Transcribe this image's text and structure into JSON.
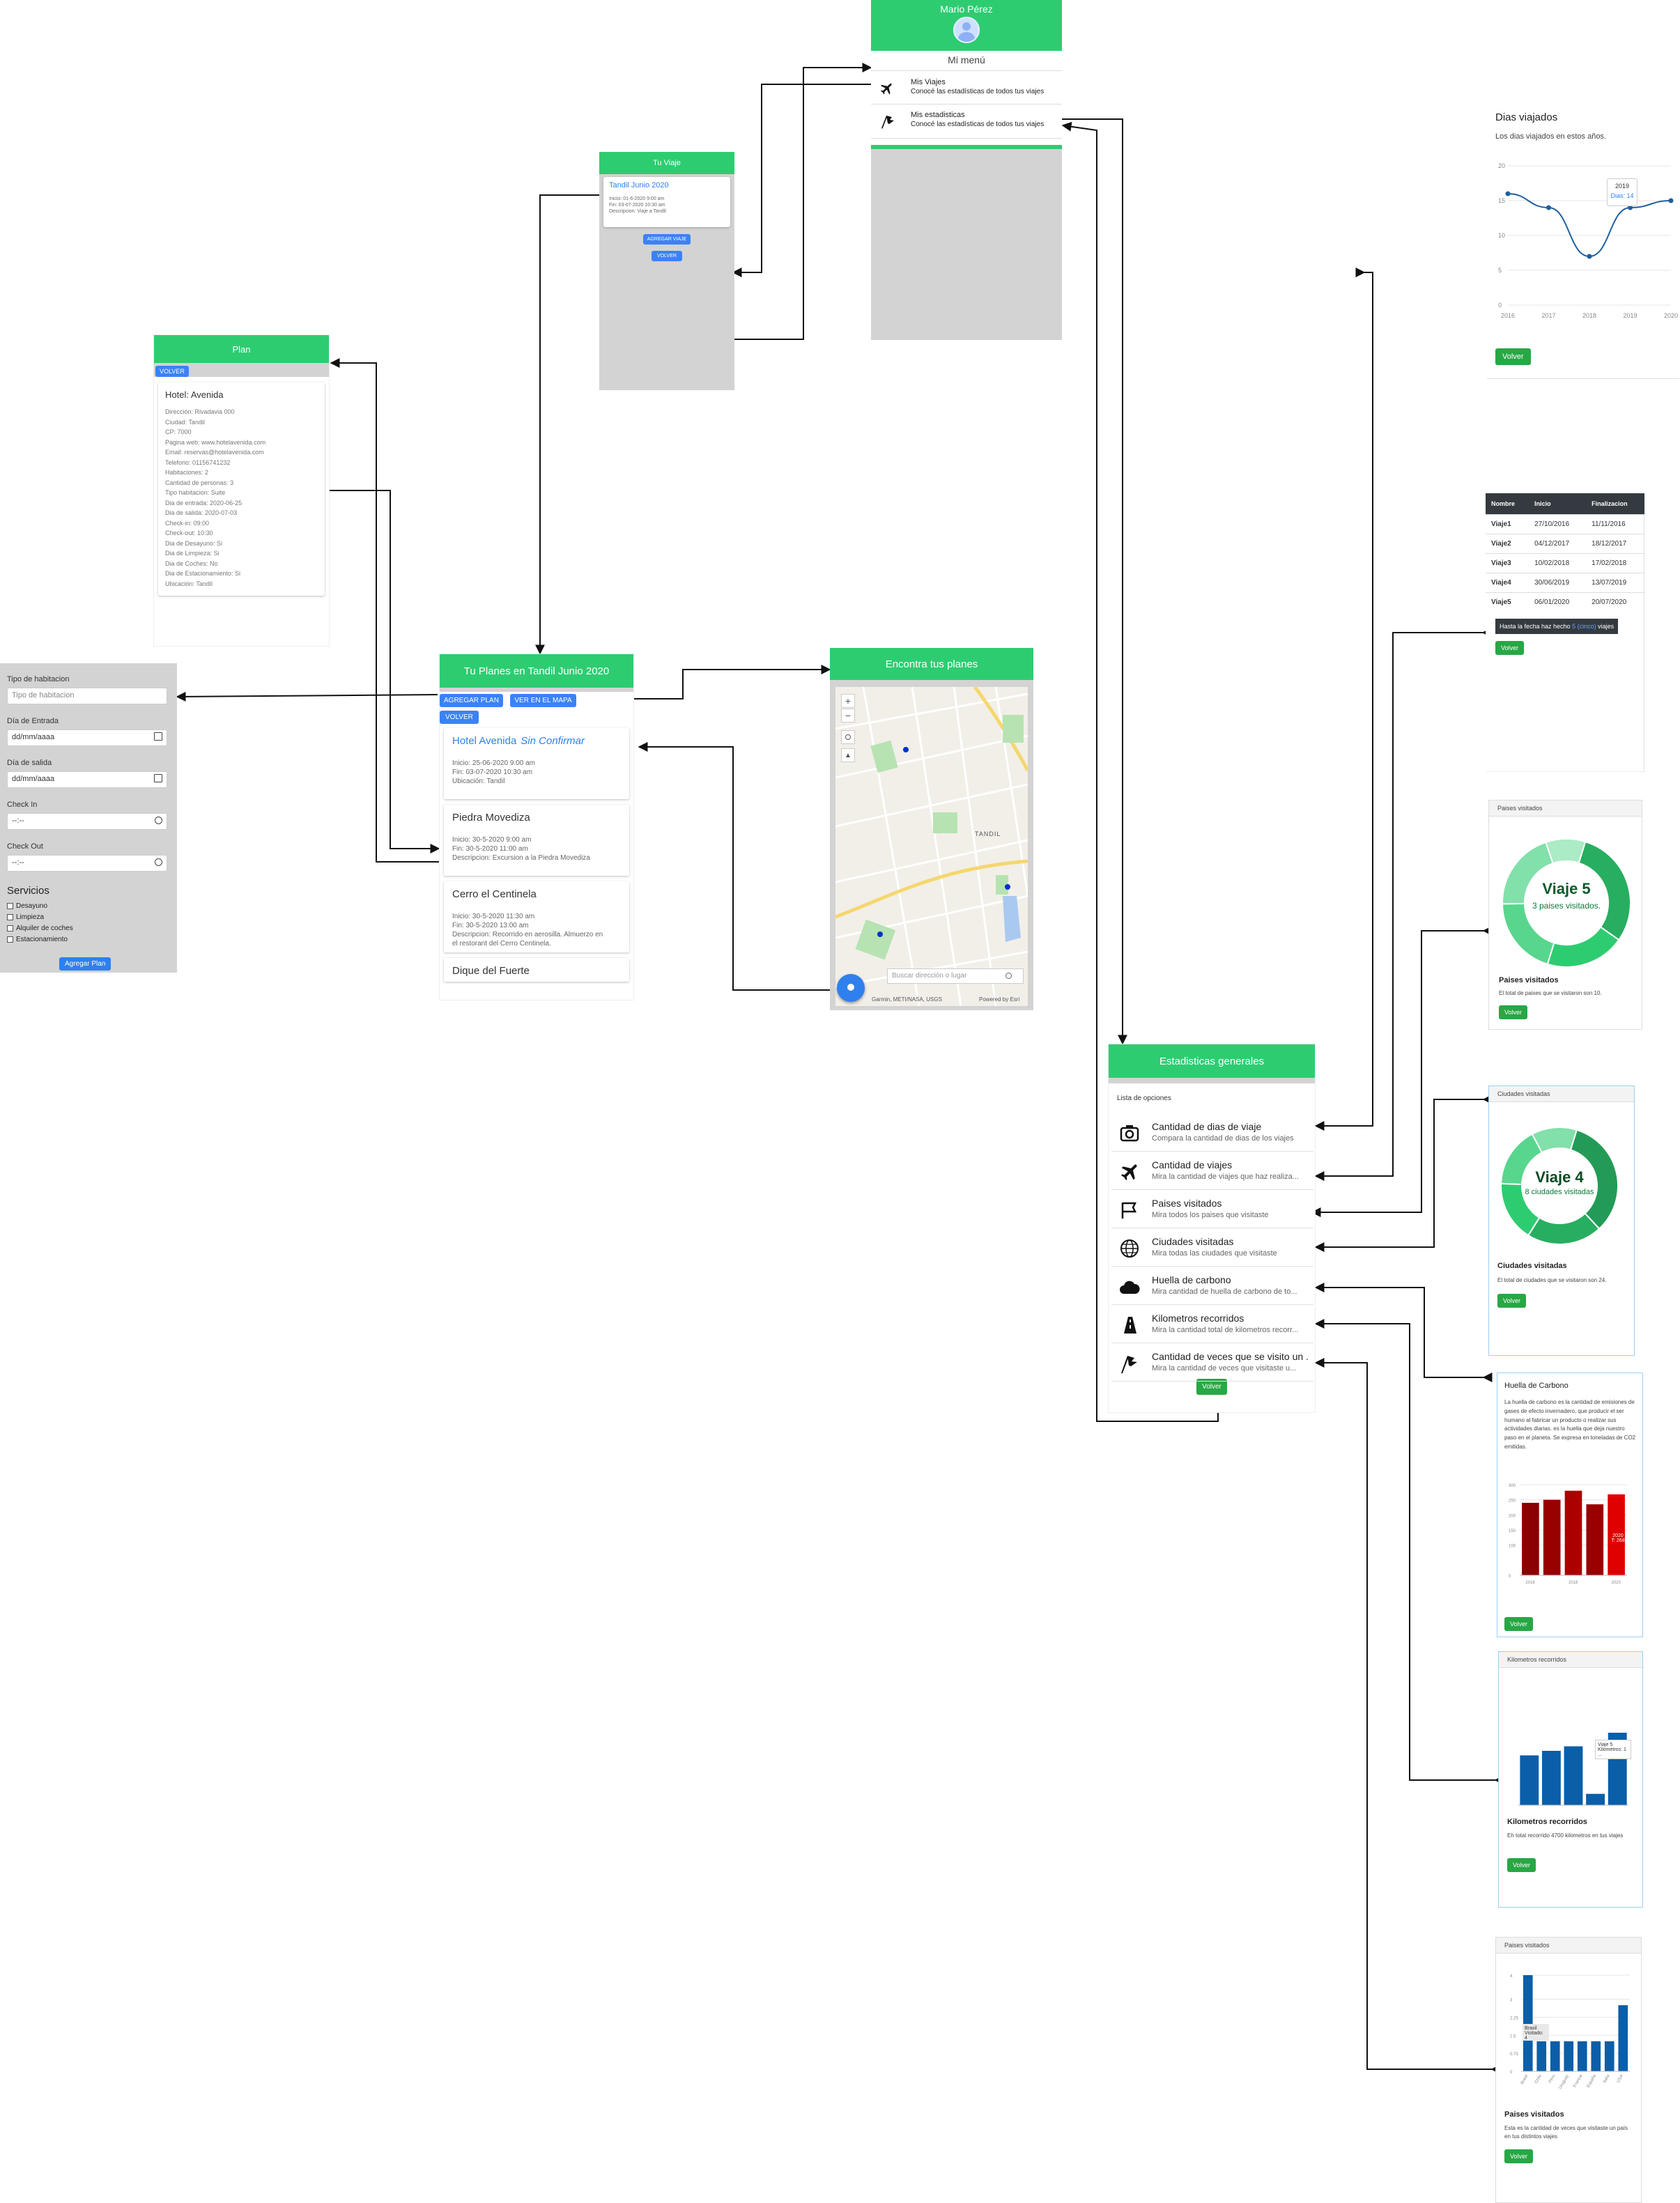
{
  "menu": {
    "user_name": "Mario Pérez",
    "title": "Mi menú",
    "items": [
      {
        "label": "Mis Viajes",
        "sub": "Conocé las estadísticas de todos tus viajes"
      },
      {
        "label": "Mis estadisticas",
        "sub": "Conocé las estadísticas de todos tus viajes"
      }
    ]
  },
  "tu_viaje": {
    "header": "Tu Viaje",
    "trip_title": "Tandil Junio 2020",
    "lines": [
      "Inicio: 01-6-2020 9:00 am",
      "Fin: 03-07-2020 10:30 am",
      "Descripcion: Viaje a Tandil"
    ],
    "add_button": "AGREGAR VIAJE",
    "back_button": "VOLVER"
  },
  "plan": {
    "header": "Plan",
    "back_button": "VOLVER",
    "hotel_title": "Hotel: Avenida",
    "details": [
      "Dirección: Rivadavia 000",
      "Ciudad: Tandil",
      "CP: 7000",
      "Pagina web: www.hotelavenida.com",
      "Email: reservas@hotelavenida.com",
      "Telefono: 01156741232",
      "Habitaciones: 2",
      "Cantidad de personas: 3",
      "Tipo habitacion: Suite",
      "Dia de entrada: 2020-06-25",
      "Dia de salida: 2020-07-03",
      "Check-in: 09:00",
      "Check-out: 10:30",
      "Dia de Desayuno: Si",
      "Dia de Limpieza: Si",
      "Dia de Coches: No",
      "Dia de Estacionamiento: Si",
      "Ubicación: Tandil"
    ]
  },
  "form": {
    "tipo_label": "Tipo de habitacion",
    "tipo_placeholder": "Tipo de habitacion",
    "entrada_label": "Día de Entrada",
    "entrada_value": "dd/mm/aaaa",
    "salida_label": "Día de salida",
    "salida_value": "dd/mm/aaaa",
    "checkin_label": "Check In",
    "checkin_value": "--:--",
    "checkout_label": "Check Out",
    "checkout_value": "--:--",
    "servicios_label": "Servicios",
    "servicios": [
      "Desayuno",
      "Limpieza",
      "Alquiler de coches",
      "Estacionamiento"
    ],
    "submit": "Agregar Plan"
  },
  "planes": {
    "header": "Tu Planes en Tandil Junio 2020",
    "btn_add": "AGREGAR PLAN",
    "btn_map": "VER EN EL MAPA",
    "btn_back": "VOLVER",
    "cards": [
      {
        "title": "Hotel Avenida",
        "tag": "Sin Confirmar",
        "lines": [
          "Inicio: 25-06-2020 9:00 am",
          "Fin: 03-07-2020 10:30 am",
          "Ubicación: Tandil"
        ]
      },
      {
        "title": "Piedra Movediza",
        "tag": "",
        "lines": [
          "Inicio: 30-5-2020 9:00 am",
          "Fin: 30-5-2020 11:00 am",
          "Descripcion: Excursion a la Piedra Movediza"
        ]
      },
      {
        "title": "Cerro el Centinela",
        "tag": "",
        "lines": [
          "Inicio: 30-5-2020 11:30 am",
          "Fin: 30-5-2020 13:00 am",
          "Descripcion: Recorrido en aerosilla. Almuerzo en",
          "el restorant del Cerro Centinela."
        ]
      },
      {
        "title": "Dique del Fuerte",
        "tag": "",
        "lines": []
      }
    ]
  },
  "mapa": {
    "header": "Encontra tus planes",
    "search_placeholder": "Buscar dirección o lugar",
    "attribution": "Garmin, METI/NASA, USGS",
    "powered": "Powered by Esri",
    "city_label": "TANDIL"
  },
  "estadisticas": {
    "header": "Estadisticas generales",
    "list_title": "Lista de opciones",
    "options": [
      {
        "label": "Cantidad de dias de viaje",
        "sub": "Compara la cantidad de dias de los viajes",
        "icon": "camera-icon"
      },
      {
        "label": "Cantidad de viajes",
        "sub": "Mira la cantidad de viajes que haz realiza...",
        "icon": "plane-icon"
      },
      {
        "label": "Paises visitados",
        "sub": "Mira todos los paises que visitaste",
        "icon": "flag-icon"
      },
      {
        "label": "Ciudades visitadas",
        "sub": "Mira todas las ciudades que visitaste",
        "icon": "globe-icon"
      },
      {
        "label": "Huella de carbono",
        "sub": "Mira cantidad de huella de carbono de to...",
        "icon": "cloud-icon"
      },
      {
        "label": "Kilometros recorridos",
        "sub": "Mira la cantidad total de kilometros recorr...",
        "icon": "road-icon"
      },
      {
        "label": "Cantidad de veces que se visito un ...",
        "sub": "Mira la cantidad de veces que visitaste u...",
        "icon": "flags-icon"
      }
    ],
    "back_button": "Volver"
  },
  "dias": {
    "title": "Dias viajados",
    "subtitle": "Los dias viajados en estos años.",
    "tooltip_year": "2019",
    "tooltip_value": "Dias: 14",
    "back_button": "Volver"
  },
  "tabla": {
    "headers": [
      "Nombre",
      "Inicio",
      "Finalizacion"
    ],
    "rows": [
      [
        "Viaje1",
        "27/10/2016",
        "11/11/2016"
      ],
      [
        "Viaje2",
        "04/12/2017",
        "18/12/2017"
      ],
      [
        "Viaje3",
        "10/02/2018",
        "17/02/2018"
      ],
      [
        "Viaje4",
        "30/06/2019",
        "13/07/2019"
      ],
      [
        "Viaje5",
        "06/01/2020",
        "20/07/2020"
      ]
    ],
    "summary_pre": "Hasta la fecha haz hecho",
    "summary_count": "5 (cinco)",
    "summary_post": "viajes",
    "back_button": "Volver"
  },
  "paises": {
    "card_header": "Paises visitados",
    "center_title": "Viaje 5",
    "center_sub": "3 paises visitados.",
    "title": "Paises visitados",
    "text": "El total de paises que se visitaron son 10.",
    "back_button": "Volver"
  },
  "ciudades": {
    "card_header": "Ciudades visitadas",
    "center_title": "Viaje 4",
    "center_sub": "8 ciudades visitadas",
    "title": "Ciudades visitadas",
    "text": "El total de ciudades que se visitaron son 24.",
    "back_button": "Volver"
  },
  "huella": {
    "title": "Huella de Carbono",
    "text": "La huella de carbono es la cantidad de emisiones de gases de efecto invernadero, que producir el ser humano al fabricar un producto o realizar sus actividades diarias. es la huella que deja nuestro paso en el planeta. Se expresa en toneladas de CO2 emitidas.",
    "tooltip": [
      "2020",
      "T: 268"
    ],
    "back_button": "Volver"
  },
  "km": {
    "card_header": "Kilometros recorridos",
    "tooltip": [
      "Viaje 5",
      "Kilometros: 1 ..."
    ],
    "title": "Kilometros recorridos",
    "text": "Eh total recorrido 4700 kilometros en tus viajes",
    "back_button": "Volver"
  },
  "veces": {
    "card_header": "Paises visitados",
    "tooltip": [
      "Brasil",
      "Visitado: 4"
    ],
    "title": "Paises visitados",
    "text": "Esta es la cantidad de veces que visitaste un país en tus distintos viajes",
    "back_button": "Volver"
  },
  "chart_data": [
    {
      "type": "line",
      "title": "Dias viajados",
      "x": [
        "2016",
        "2017",
        "2018",
        "2019",
        "2020"
      ],
      "series": [
        {
          "name": "Dias",
          "values": [
            16,
            14,
            7,
            14,
            15
          ]
        }
      ],
      "ylim": [
        0,
        20
      ],
      "yticks": [
        "0",
        "5",
        "10",
        "15",
        "20"
      ]
    },
    {
      "type": "pie",
      "title": "Paises visitados",
      "values": [
        3,
        2,
        2,
        2,
        1
      ],
      "colors": [
        "#27ae60",
        "#2ecc71",
        "#58d68d",
        "#82e0aa",
        "#abebc6"
      ]
    },
    {
      "type": "pie",
      "title": "Ciudades visitadas",
      "values": [
        8,
        5,
        4,
        4,
        3
      ],
      "colors": [
        "#239b56",
        "#27ae60",
        "#2ecc71",
        "#58d68d",
        "#82e0aa"
      ]
    },
    {
      "type": "bar",
      "title": "Huella de Carbono",
      "categories": [
        "2016",
        "2017",
        "2018",
        "2019",
        "2020"
      ],
      "values": [
        240,
        250,
        280,
        235,
        268
      ],
      "xticks": [
        "2016",
        "2018",
        "2020"
      ],
      "yticks": [
        "0",
        "100",
        "150",
        "200",
        "250",
        "300"
      ],
      "ylim": [
        0,
        300
      ],
      "colors": [
        "#8b0000",
        "#990000",
        "#aa0000",
        "#990000",
        "#e00000"
      ]
    },
    {
      "type": "bar",
      "title": "Kilometros recorridos",
      "categories": [
        "Viaje1",
        "Viaje2",
        "Viaje3",
        "Viaje4",
        "Viaje5"
      ],
      "values": [
        1100,
        1200,
        1300,
        250,
        1600
      ],
      "ylim": [
        0,
        2000
      ],
      "color": "#0b5ea8"
    },
    {
      "type": "bar",
      "title": "Paises visitados",
      "categories": [
        "Brasil",
        "Chile",
        "Peru",
        "Uruguay",
        "Francia",
        "España",
        "Italia",
        "USA"
      ],
      "values": [
        4,
        1.25,
        1.25,
        1.25,
        1.25,
        1.25,
        1.25,
        2.75
      ],
      "yticks": [
        "0",
        "0.75",
        "1.5",
        "2.25",
        "3",
        "4"
      ],
      "ylim": [
        0,
        4
      ],
      "color": "#0b5ea8"
    }
  ]
}
